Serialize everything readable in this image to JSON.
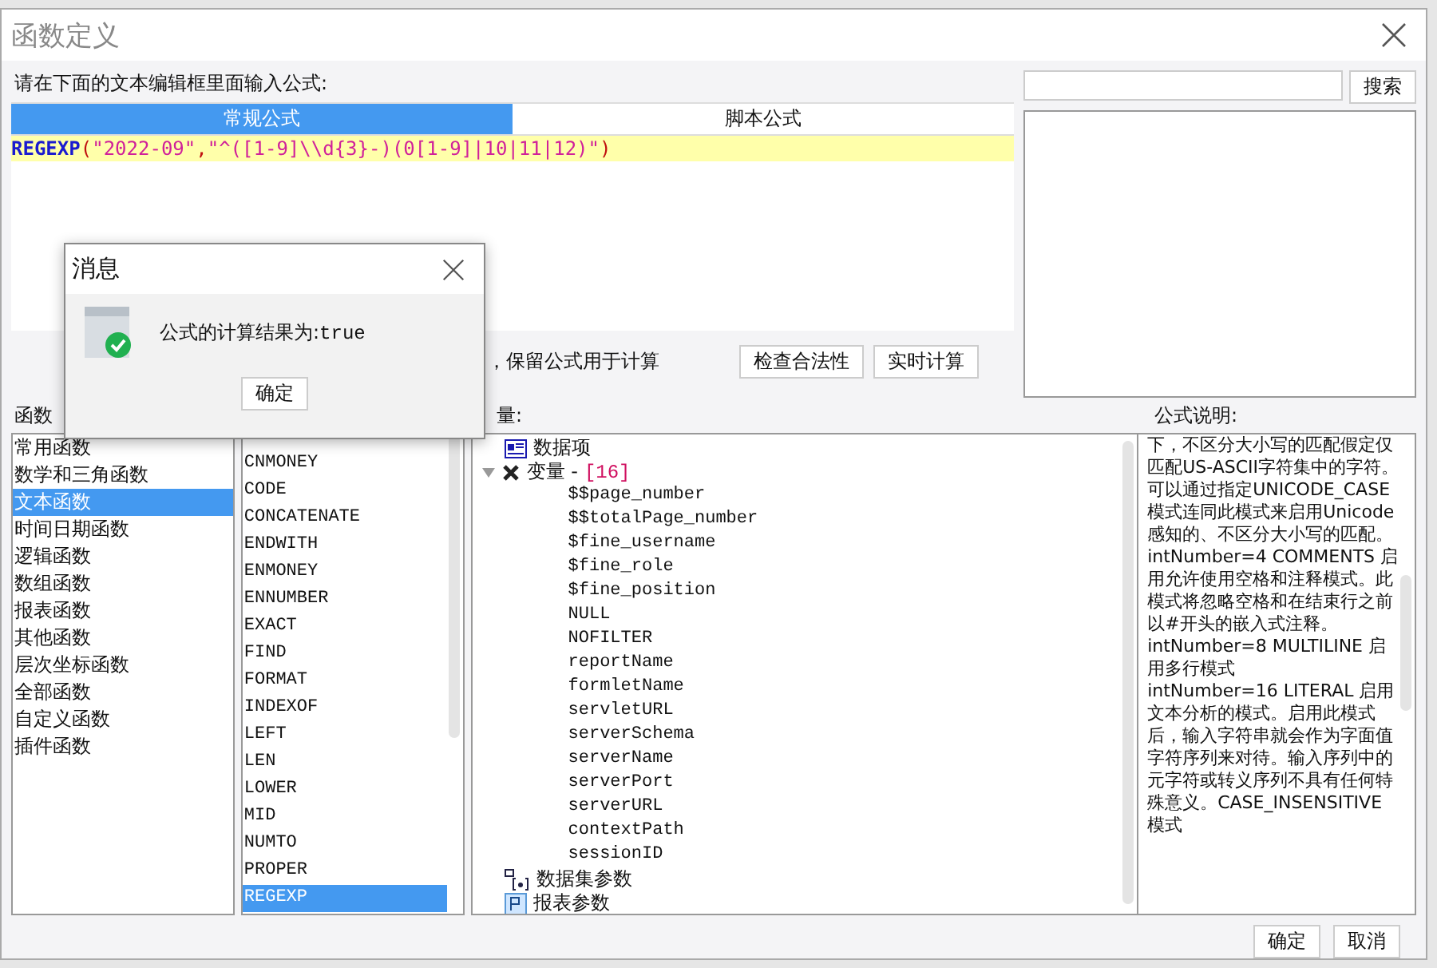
{
  "window": {
    "title": "函数定义"
  },
  "editor": {
    "prompt": "请在下面的文本编辑框里面输入公式:",
    "tabs": [
      {
        "label": "常规公式",
        "selected": true
      },
      {
        "label": "脚本公式",
        "selected": false
      }
    ],
    "formula": [
      {
        "kind": "func",
        "text": "REGEXP"
      },
      {
        "kind": "punct",
        "text": "("
      },
      {
        "kind": "str",
        "text": "\"2022-09\""
      },
      {
        "kind": "punct",
        "text": ","
      },
      {
        "kind": "str",
        "text": "\"^([1-9]\\\\d{3}-)(0[1-9]|10|11|12)\""
      },
      {
        "kind": "punct",
        "text": ")"
      }
    ],
    "option_label": "，保留公式用于计算",
    "buttons": [
      "检查合法性",
      "实时计算"
    ]
  },
  "search": {
    "button": "搜索"
  },
  "categories": {
    "label": "函数",
    "items": [
      {
        "label": "常用函数",
        "selected": false
      },
      {
        "label": "数学和三角函数",
        "selected": false
      },
      {
        "label": "文本函数",
        "selected": true
      },
      {
        "label": "时间日期函数",
        "selected": false
      },
      {
        "label": "逻辑函数",
        "selected": false
      },
      {
        "label": "数组函数",
        "selected": false
      },
      {
        "label": "报表函数",
        "selected": false
      },
      {
        "label": "其他函数",
        "selected": false
      },
      {
        "label": "层次坐标函数",
        "selected": false
      },
      {
        "label": "全部函数",
        "selected": false
      },
      {
        "label": "自定义函数",
        "selected": false
      },
      {
        "label": "插件函数",
        "selected": false
      }
    ]
  },
  "functions": {
    "items": [
      {
        "label": "CNMONEY",
        "selected": false
      },
      {
        "label": "CODE",
        "selected": false
      },
      {
        "label": "CONCATENATE",
        "selected": false
      },
      {
        "label": "ENDWITH",
        "selected": false
      },
      {
        "label": "ENMONEY",
        "selected": false
      },
      {
        "label": "ENNUMBER",
        "selected": false
      },
      {
        "label": "EXACT",
        "selected": false
      },
      {
        "label": "FIND",
        "selected": false
      },
      {
        "label": "FORMAT",
        "selected": false
      },
      {
        "label": "INDEXOF",
        "selected": false
      },
      {
        "label": "LEFT",
        "selected": false
      },
      {
        "label": "LEN",
        "selected": false
      },
      {
        "label": "LOWER",
        "selected": false
      },
      {
        "label": "MID",
        "selected": false
      },
      {
        "label": "NUMTO",
        "selected": false
      },
      {
        "label": "PROPER",
        "selected": false
      },
      {
        "label": "REGEXP",
        "selected": true
      }
    ]
  },
  "variables": {
    "label": "量:",
    "tree": [
      {
        "kind": "data-item",
        "label": "数据项"
      },
      {
        "kind": "variable",
        "label": "变量 -",
        "count": "[16]",
        "expanded": true,
        "children": [
          {
            "label": "$$page_number"
          },
          {
            "label": "$$totalPage_number"
          },
          {
            "label": "$fine_username"
          },
          {
            "label": "$fine_role"
          },
          {
            "label": "$fine_position"
          },
          {
            "label": "NULL"
          },
          {
            "label": "NOFILTER"
          },
          {
            "label": "reportName"
          },
          {
            "label": "formletName"
          },
          {
            "label": "servletURL"
          },
          {
            "label": "serverSchema"
          },
          {
            "label": "serverName"
          },
          {
            "label": "serverPort"
          },
          {
            "label": "serverURL"
          },
          {
            "label": "contextPath"
          },
          {
            "label": "sessionID"
          }
        ]
      },
      {
        "kind": "dataset-param",
        "label": "数据集参数"
      },
      {
        "kind": "report-param",
        "label": "报表参数"
      }
    ]
  },
  "description": {
    "label": "公式说明:",
    "paragraphs": [
      "下，不区分大小写的匹配假定仅匹配US-ASCII字符集中的字符。可以通过指定UNICODE_CASE模式连同此模式来启用Unicode感知的、不区分大小写的匹配。",
      "intNumber=4 COMMENTS 启用允许使用空格和注释模式。此模式将忽略空格和在结束行之前以#开头的嵌入式注释。",
      "intNumber=8 MULTILINE 启用多行模式",
      "intNumber=16 LITERAL 启用文本分析的模式。启用此模式后，输入字符串就会作为字面值字符序列来对待。输入序列中的元字符或转义序列不具有任何特殊意义。CASE_INSENSITIVE模式"
    ]
  },
  "footer": {
    "buttons": [
      "确定",
      "取消"
    ]
  },
  "message": {
    "title": "消息",
    "text": "公式的计算结果为:",
    "result": "true",
    "button": "确定"
  }
}
